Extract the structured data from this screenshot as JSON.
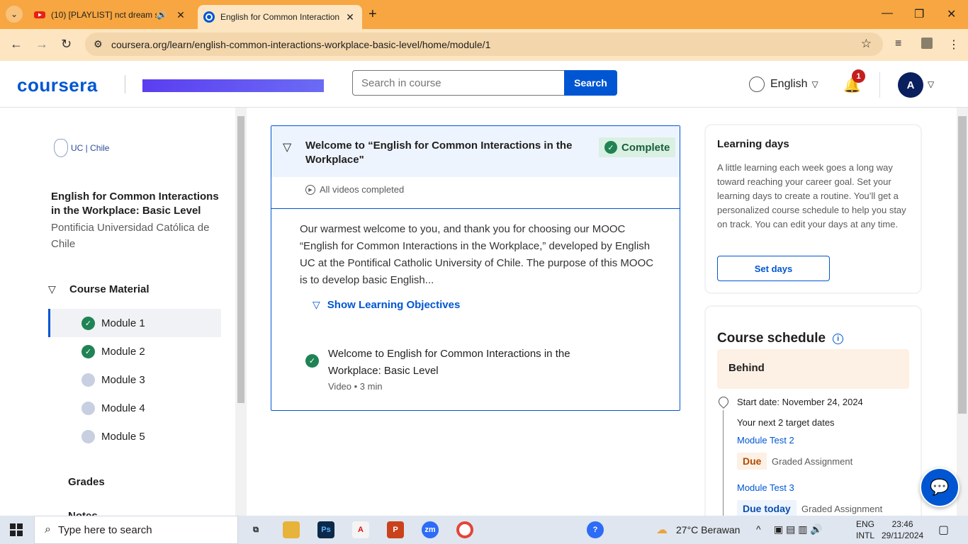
{
  "browser": {
    "tabs": [
      {
        "title": "(10) [PLAYLIST] nct dream s",
        "active": false
      },
      {
        "title": "English for Common Interaction",
        "active": true
      }
    ],
    "url": "coursera.org/learn/english-common-interactions-workplace-basic-level/home/module/1"
  },
  "header": {
    "logo": "coursera",
    "search_placeholder": "Search in course",
    "search_button": "Search",
    "language": "English",
    "notification_count": "1",
    "avatar_initial": "A"
  },
  "sidebar": {
    "partner_logo": "UC | Chile",
    "course_title": "English for Common Interactions in the Workplace: Basic Level",
    "course_org": "Pontificia Universidad Católica de Chile",
    "section": "Course Material",
    "modules": [
      {
        "label": "Module 1",
        "status": "done"
      },
      {
        "label": "Module 2",
        "status": "done"
      },
      {
        "label": "Module 3",
        "status": "todo"
      },
      {
        "label": "Module 4",
        "status": "todo"
      },
      {
        "label": "Module 5",
        "status": "todo"
      }
    ],
    "grades": "Grades",
    "notes": "Notes"
  },
  "module": {
    "title": "Welcome to “English for Common Interactions in the Workplace\"",
    "status": "Complete",
    "videos_status": "All videos completed",
    "description": "Our warmest welcome to you, and thank you for choosing our MOOC “English for Common Interactions in the Workplace,” developed by English UC at the Pontifical Catholic University of Chile. The purpose of this MOOC is to develop basic English...",
    "show_objectives": "Show Learning Objectives",
    "items": [
      {
        "name": "Welcome to English for Common Interactions in the Workplace: Basic Level",
        "meta": "Video • 3 min"
      }
    ]
  },
  "learning_days": {
    "heading": "Learning days",
    "text": "A little learning each week goes a long way toward reaching your career goal. Set your learning days to create a routine. You’ll get a personalized course schedule to help you stay on track. You can edit your days at any time.",
    "button": "Set days"
  },
  "schedule": {
    "heading": "Course schedule",
    "status": "Behind",
    "start_date": "Start date: November 24, 2024",
    "next_targets": "Your next 2 target dates",
    "targets": [
      {
        "name": "Module Test 2",
        "due": "Due",
        "type": "Graded Assignment"
      },
      {
        "name": "Module Test 3",
        "due": "Due today",
        "type": "Graded Assignment"
      }
    ]
  },
  "taskbar": {
    "search_placeholder": "Type here to search",
    "weather": "27°C  Berawan",
    "lang_top": "ENG",
    "lang_bottom": "INTL",
    "time": "23:46",
    "date": "29/11/2024"
  }
}
